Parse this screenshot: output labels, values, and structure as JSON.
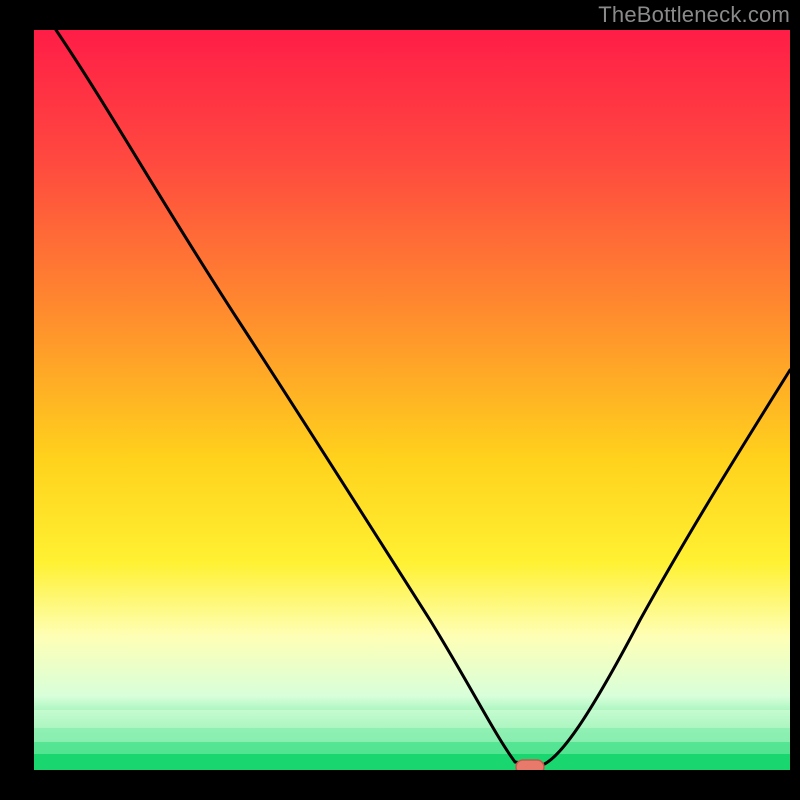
{
  "watermark": "TheBottleneck.com",
  "colors": {
    "black": "#000000",
    "curve": "#000000",
    "marker_fill": "#e77a6b",
    "marker_stroke": "#c45a4d"
  },
  "chart_data": {
    "type": "line",
    "title": "",
    "xlabel": "",
    "ylabel": "",
    "xlim": [
      0,
      100
    ],
    "ylim": [
      0,
      100
    ],
    "grid": false,
    "legend": false,
    "background": "vertical-gradient red→orange→yellow→pale→green",
    "series": [
      {
        "name": "bottleneck-curve",
        "x": [
          3,
          10,
          20,
          27,
          35,
          45,
          55,
          60,
          63,
          65,
          67,
          72,
          80,
          90,
          100
        ],
        "y": [
          100,
          88,
          72,
          61,
          49,
          33,
          17,
          8,
          2,
          0,
          0,
          7,
          22,
          42,
          62
        ]
      }
    ],
    "marker": {
      "x": 66,
      "y": 0,
      "shape": "rounded-pill"
    },
    "gradient_stops": [
      {
        "pct": 0,
        "color": "#ff1d47"
      },
      {
        "pct": 18,
        "color": "#ff4a3f"
      },
      {
        "pct": 38,
        "color": "#ff8b2e"
      },
      {
        "pct": 58,
        "color": "#ffd21c"
      },
      {
        "pct": 72,
        "color": "#fff133"
      },
      {
        "pct": 82,
        "color": "#feffb6"
      },
      {
        "pct": 90,
        "color": "#d8ffda"
      },
      {
        "pct": 95,
        "color": "#68e89a"
      },
      {
        "pct": 100,
        "color": "#19d66f"
      }
    ]
  }
}
